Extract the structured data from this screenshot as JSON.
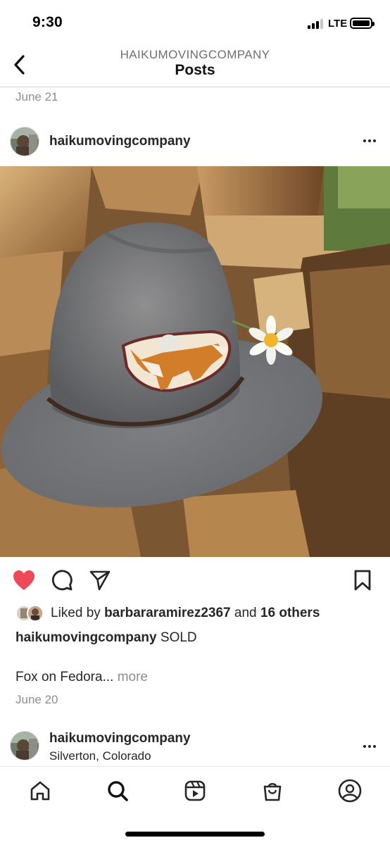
{
  "status_bar": {
    "time": "9:30",
    "network": "LTE",
    "signal_bars": 3,
    "battery_percent": 100
  },
  "header": {
    "subtitle": "HAIKUMOVINGCOMPANY",
    "title": "Posts",
    "back_icon": "chevron-left-icon"
  },
  "posts": [
    {
      "date_above": "June 21",
      "username": "haikumovingcompany",
      "image_description_icon": "photo",
      "liked": true,
      "likes": {
        "prefix": "Liked by",
        "user": "barbararamirez2367",
        "joiner": "and",
        "others": "16 others"
      },
      "caption_user": "haikumovingcompany",
      "caption_text": "SOLD",
      "caption_body": "Fox on Fedora...",
      "more_label": "more",
      "date": "June 20"
    },
    {
      "username": "haikumovingcompany",
      "location": "Silverton, Colorado"
    }
  ],
  "actions": {
    "like_icon": "heart-filled-icon",
    "comment_icon": "comment-icon",
    "share_icon": "paper-plane-icon",
    "save_icon": "bookmark-icon"
  },
  "tab_bar": {
    "items": [
      "home",
      "search",
      "reels",
      "shop",
      "profile"
    ],
    "active": "search"
  },
  "colors": {
    "like_red": "#ed4956",
    "text": "#262626",
    "muted": "#8e8e8e",
    "divider": "#dbdbdb"
  }
}
